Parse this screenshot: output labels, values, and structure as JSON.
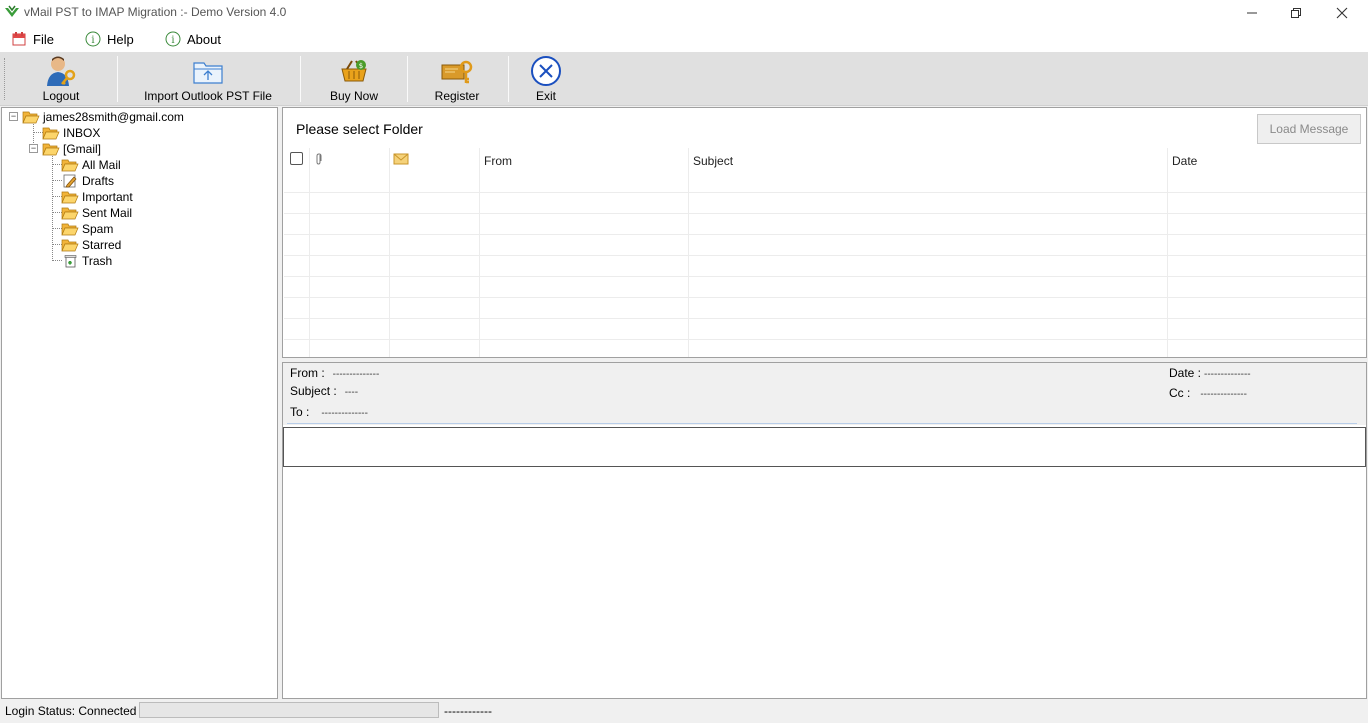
{
  "window": {
    "title": "vMail PST to IMAP Migration :- Demo Version 4.0",
    "minimize_icon": "minimize-icon",
    "restore_icon": "restore-icon",
    "close_icon": "close-icon"
  },
  "menu": {
    "items": [
      {
        "label": "File",
        "icon": "calendar-icon"
      },
      {
        "label": "Help",
        "icon": "info-icon"
      },
      {
        "label": "About",
        "icon": "info-icon"
      }
    ]
  },
  "toolbar": {
    "logout": "Logout",
    "import": "Import Outlook PST File",
    "buy": "Buy Now",
    "register": "Register",
    "exit": "Exit"
  },
  "tree": {
    "account": "james28smith@gmail.com",
    "inbox": "INBOX",
    "gmail": "[Gmail]",
    "children": [
      "All Mail",
      "Drafts",
      "Important",
      "Sent Mail",
      "Spam",
      "Starred",
      "Trash"
    ]
  },
  "list": {
    "title": "Please select Folder",
    "load_button": "Load Message",
    "headers": {
      "from": "From",
      "subject": "Subject",
      "date": "Date"
    }
  },
  "preview": {
    "from_label": "From :",
    "from_value": "--------------",
    "subject_label": "Subject :",
    "subject_value": "----",
    "to_label": "To :",
    "to_value": "--------------",
    "date_label": "Date :",
    "date_value": "--------------",
    "cc_label": "Cc :",
    "cc_value": "--------------"
  },
  "status": {
    "text": "Login Status: Connected",
    "progress": 0,
    "dashes": "------------"
  },
  "colors": {
    "folder": "#f6c04a",
    "exit_blue": "#1a4fbf",
    "progress_green": "#06b025"
  }
}
